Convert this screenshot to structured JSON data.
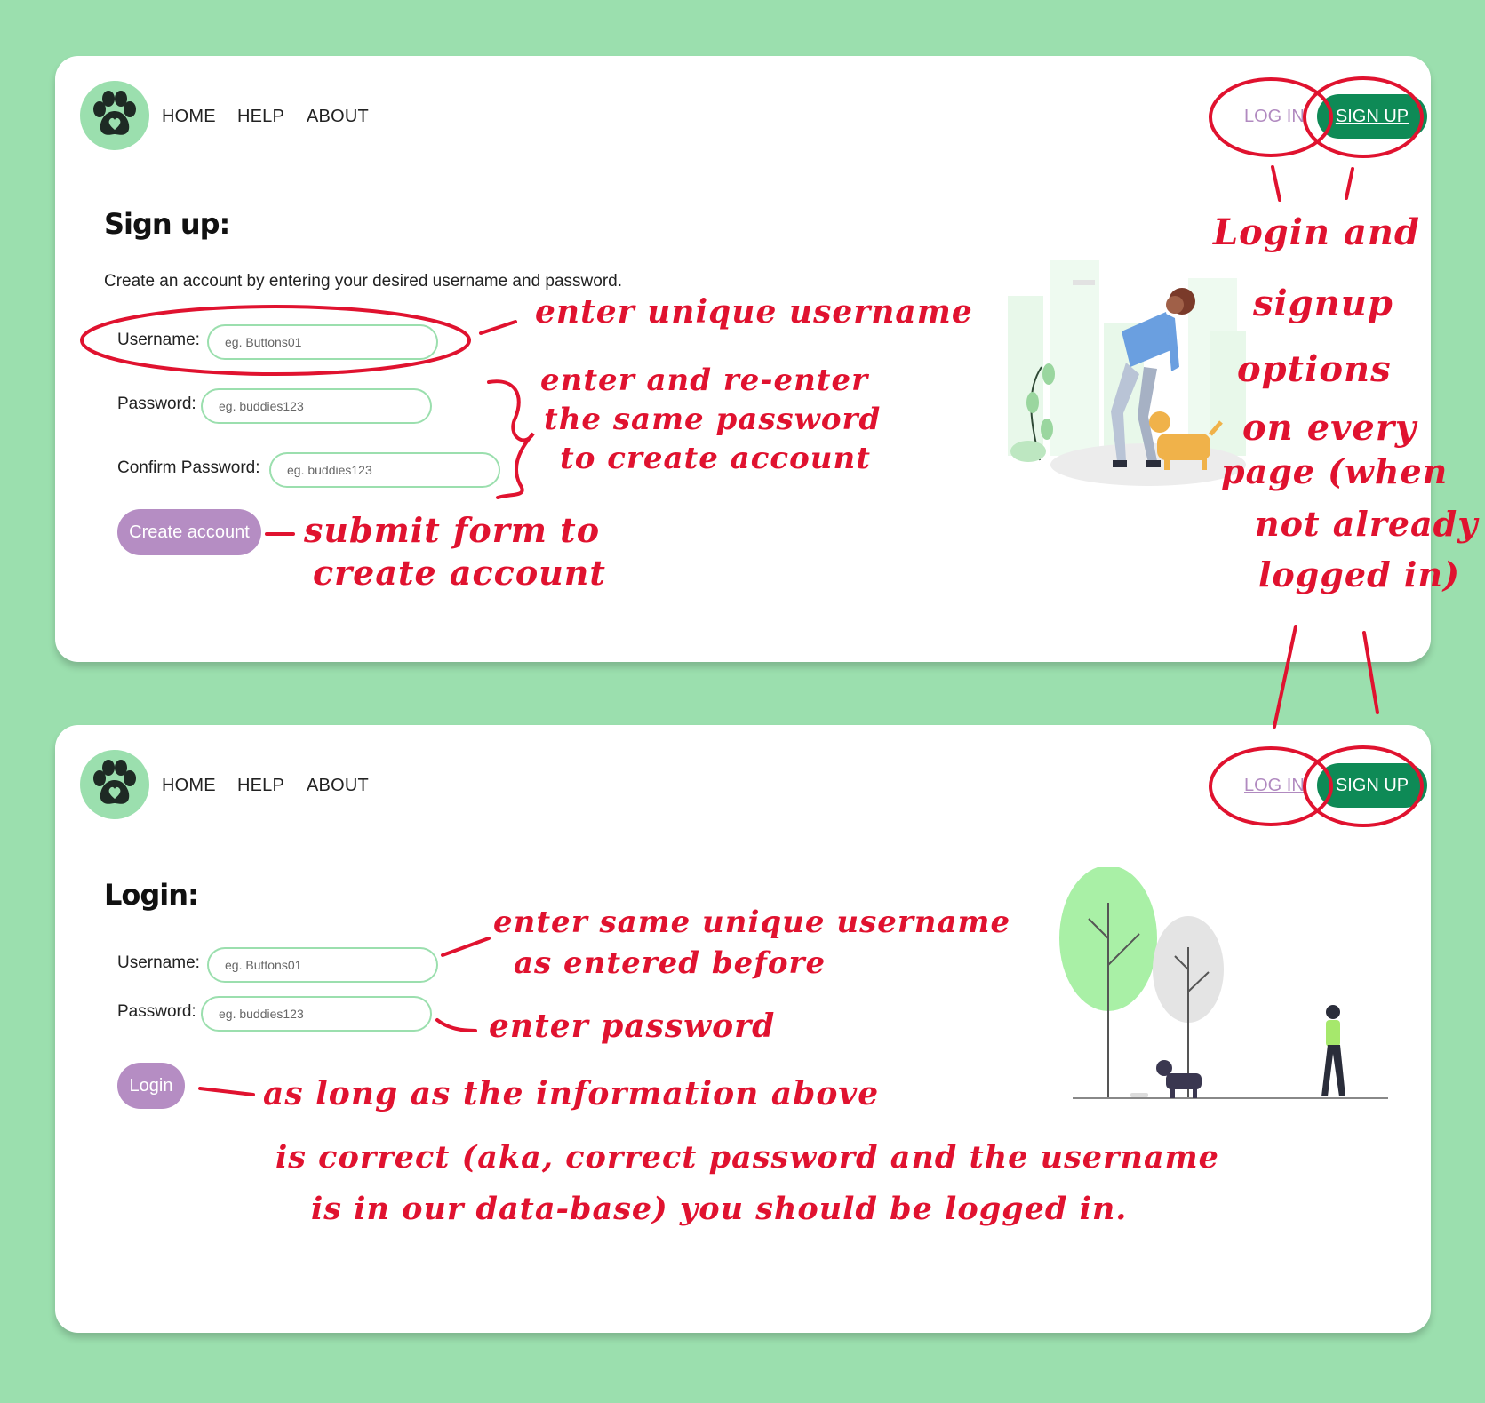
{
  "nav": {
    "home": "HOME",
    "help": "HELP",
    "about": "ABOUT",
    "login": "LOG IN",
    "signup": "SIGN UP"
  },
  "signup_page": {
    "title": "Sign up:",
    "intro": "Create an account by entering your desired username and password.",
    "username_label": "Username:",
    "username_placeholder": "eg. Buttons01",
    "password_label": "Password:",
    "password_placeholder": "eg. buddies123",
    "confirm_label": "Confirm Password:",
    "confirm_placeholder": "eg. buddies123",
    "submit_label": "Create account"
  },
  "login_page": {
    "title": "Login:",
    "username_label": "Username:",
    "username_placeholder": "eg. Buttons01",
    "password_label": "Password:",
    "password_placeholder": "eg. buddies123",
    "submit_label": "Login"
  },
  "annotations": {
    "unique_username": "enter unique username",
    "password_line1": "enter and re-enter",
    "password_line2": "the same password",
    "password_line3": "to create account",
    "submit_line1": "submit form to",
    "submit_line2": "create account",
    "options_line1": "Login and",
    "options_line2": "signup",
    "options_line3": "options",
    "options_line4": "on every",
    "options_line5": "page (when",
    "options_line6": "not already",
    "options_line7": "logged in)",
    "same_username_line1": "enter same unique username",
    "same_username_line2": "as entered before",
    "enter_password": "enter password",
    "login_line1": "as long as the information above",
    "login_line2": "is correct (aka, correct password and the username",
    "login_line3": "is in our data-base) you should be logged in."
  },
  "colors": {
    "background": "#9bdfae",
    "accent_green": "#0e8a56",
    "accent_purple": "#b58dc3",
    "annotation_red": "#e0122f"
  },
  "icons": {
    "logo": "paw-heart-icon"
  }
}
